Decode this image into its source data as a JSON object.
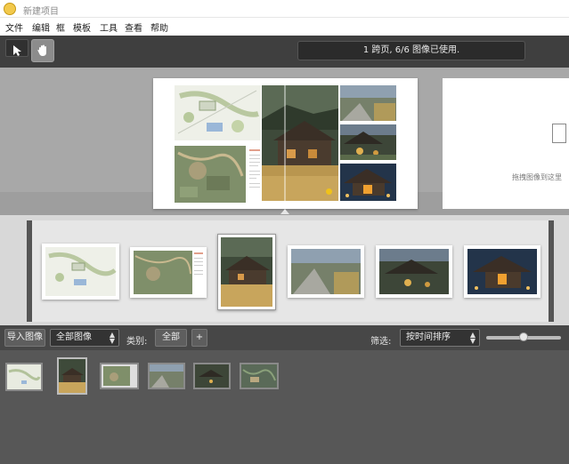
{
  "window": {
    "title": "新建项目"
  },
  "menu": [
    "文件",
    "编辑",
    "框",
    "模板",
    "工具",
    "查看",
    "帮助"
  ],
  "toolbar": {
    "select_tool": "select-tool",
    "hand_tool": "hand-tool",
    "status": "1 跨页, 6/6 图像已使用."
  },
  "canvas": {
    "next_page_hint": "拖拽图像到这里"
  },
  "filmstrip": {
    "pages": [
      "site-plan",
      "grading-plan",
      "house-meadow",
      "stone-path",
      "courtyard-evening",
      "house-night"
    ],
    "selected_index": 2
  },
  "bottom_bar": {
    "import_button": "导入图像",
    "image_filter": "全部图像",
    "category_label": "类别:",
    "category_all": "全部",
    "add_category": "+",
    "filter_label": "筛选:",
    "sort_option": "按时间排序",
    "zoom_level": 0.5
  },
  "library": {
    "items": [
      "site-plan",
      "house-meadow",
      "grading-plan",
      "stone-path",
      "courtyard-evening",
      "house-night"
    ],
    "selected_index": 1
  },
  "colors": {
    "toolbar_bg": "#3f3f3f",
    "canvas_bg": "#9e9e9e",
    "library_bg": "#575757",
    "accent_yellow": "#f0c21a"
  }
}
